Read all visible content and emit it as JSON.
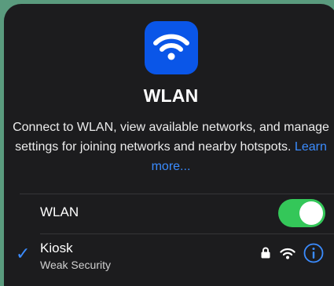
{
  "header": {
    "title": "WLAN",
    "description": "Connect to WLAN, view available networks, and manage settings for joining networks and nearby hotspots.",
    "learn_more": "Learn more..."
  },
  "wlan_toggle": {
    "label": "WLAN",
    "state": "on"
  },
  "networks": [
    {
      "name": "Kiosk",
      "subtitle": "Weak Security",
      "connected": true,
      "secured": true,
      "icons": [
        "lock-icon",
        "wifi-icon",
        "info-icon"
      ]
    }
  ],
  "colors": {
    "accent": "#3b8cff",
    "toggle_on": "#34c759",
    "app_icon_bg": "#0a56e8",
    "panel_bg": "#1c1c1e"
  }
}
